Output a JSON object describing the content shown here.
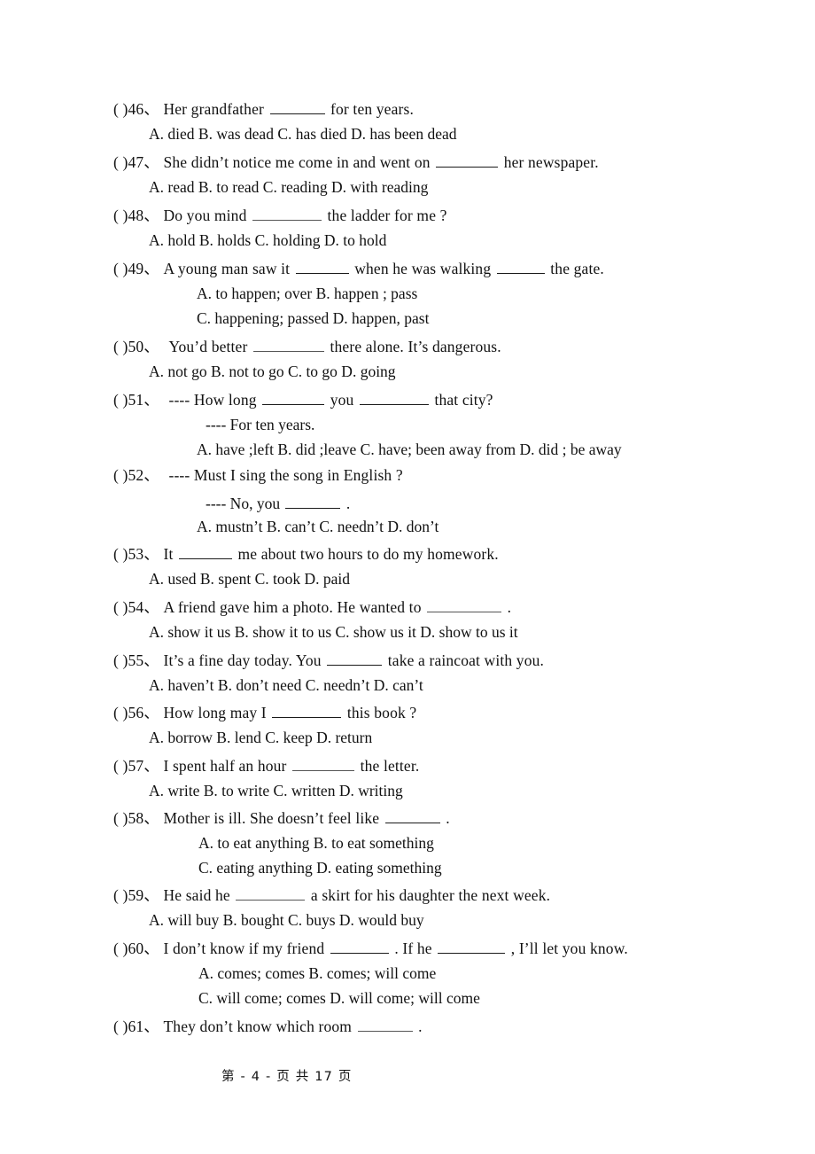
{
  "document": {
    "page_label": "第 - 4 - 页 共 17 页",
    "page_number": "4",
    "total_pages": "17",
    "bracket": "(    )",
    "number_separator": "、"
  },
  "questions": [
    {
      "id": "46",
      "marker": "(    )46、",
      "stem_before": "Her grandfather",
      "stem_after": "for ten years.",
      "options_line": "A. died      B. was dead    C. has died    D. has been dead"
    },
    {
      "id": "47",
      "marker": "(    )47、",
      "stem_before": "She didn’t notice me come in and went on",
      "stem_after": "her newspaper.",
      "options_line": "A. read      B. to read     C. reading     D. with reading"
    },
    {
      "id": "48",
      "marker": "(    )48、",
      "stem_before": "Do you mind",
      "stem_after": "the ladder for me ?",
      "options_line": "A. hold      B. holds       C. holding     D. to hold"
    },
    {
      "id": "49",
      "marker": "(    )49、",
      "stem_before": "A young man saw it",
      "stem_mid": "when he was walking",
      "stem_after": "the gate.",
      "options_line_1": "A. to happen; over            B. happen ; pass",
      "options_line_2": "C. happening; passed        D. happen, past"
    },
    {
      "id": "50",
      "marker": "(    )50、",
      "stem_before": "You’d better",
      "stem_after": "there alone. It’s dangerous.",
      "options_line": "A. not go      B. not to go     C. to go      D. going"
    },
    {
      "id": "51",
      "marker": "(    )51、",
      "stem_before": "---- How long",
      "stem_mid": "you",
      "stem_after": "that city?",
      "answer_line": "---- For ten years.",
      "options_line": "A. have ;left   B. did ;leave   C. have; been away from  D. did ; be away"
    },
    {
      "id": "52",
      "marker": "(    )52、",
      "stem_full": "---- Must I sing the song in English ?",
      "answer_before": "---- No, you",
      "answer_after": ".",
      "options_line": "A. mustn’t        B. can’t        C. needn’t      D. don’t"
    },
    {
      "id": "53",
      "marker": "(    )53、",
      "stem_before": "It",
      "stem_after": "me about two hours to do my homework.",
      "options_line": "A. used        B. spent          C. took        D. paid"
    },
    {
      "id": "54",
      "marker": "(    )54、",
      "stem_before": "A friend gave him a photo. He wanted to",
      "stem_after": ".",
      "options_line": "A. show it us    B. show it to us   C. show us it    D. show to us it"
    },
    {
      "id": "55",
      "marker": "(    )55、",
      "stem_before": "It’s a fine day today. You",
      "stem_after": "take a raincoat with you.",
      "options_line": "A. haven’t    B. don’t need     C. needn’t       D. can’t"
    },
    {
      "id": "56",
      "marker": "(    )56、",
      "stem_before": "How long may I",
      "stem_after": "this book ?",
      "options_line": "A. borrow    B. lend      C. keep       D. return"
    },
    {
      "id": "57",
      "marker": "(    )57、",
      "stem_before": "I spent half an hour",
      "stem_after": "the letter.",
      "options_line": "A. write       B. to write    C. written     D. writing"
    },
    {
      "id": "58",
      "marker": "(    )58、",
      "stem_before": "Mother is ill. She doesn’t feel like",
      "stem_after": ".",
      "options_line_1": "A. to eat anything           B. to eat something",
      "options_line_2": "C. eating anything          D. eating something"
    },
    {
      "id": "59",
      "marker": "(    )59、",
      "stem_before": "He said he",
      "stem_after": "a skirt for his daughter the next week.",
      "options_line": "A. will buy    B. bought     C. buys       D. would buy"
    },
    {
      "id": "60",
      "marker": "(    )60、",
      "stem_before": "I don’t know if my friend",
      "stem_mid": ". If he",
      "stem_after": ", I’ll let you know.",
      "options_line_1": "A. comes; comes            B. comes; will come",
      "options_line_2": "C. will come; comes        D. will come; will come"
    },
    {
      "id": "61",
      "marker": "(    )61、",
      "stem_before": "They don’t know which room",
      "stem_after": "."
    }
  ]
}
